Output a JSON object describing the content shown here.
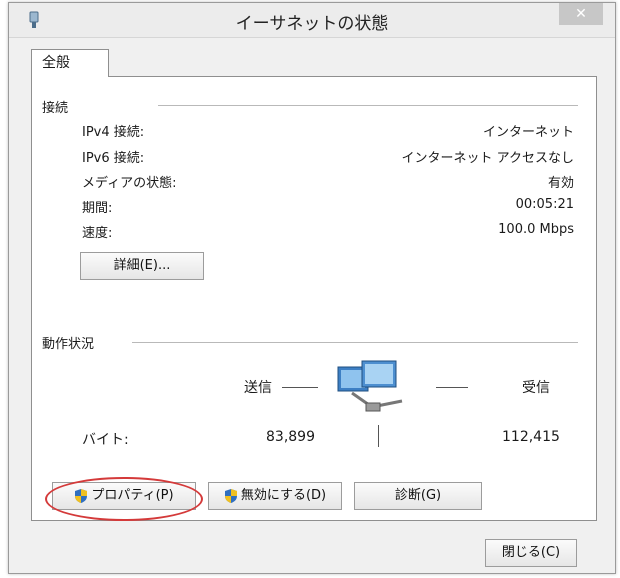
{
  "window": {
    "title": "イーサネットの状態",
    "close_label": "✕"
  },
  "tab": {
    "label": "全般"
  },
  "connection": {
    "section_title": "接続",
    "rows": [
      {
        "label": "IPv4 接続:",
        "value": "インターネット"
      },
      {
        "label": "IPv6 接続:",
        "value": "インターネット アクセスなし"
      },
      {
        "label": "メディアの状態:",
        "value": "有効"
      },
      {
        "label": "期間:",
        "value": "00:05:21"
      },
      {
        "label": "速度:",
        "value": "100.0 Mbps"
      }
    ],
    "details_button": "詳細(E)..."
  },
  "activity": {
    "section_title": "動作状況",
    "sent_label": "送信",
    "received_label": "受信",
    "bytes_label": "バイト:",
    "bytes_sent": "83,899",
    "bytes_received": "112,415",
    "network_icon": "network-computers-icon"
  },
  "buttons": {
    "properties": "プロパティ(P)",
    "disable": "無効にする(D)",
    "diagnose": "診断(G)",
    "close": "閉じる(C)"
  },
  "colors": {
    "highlight": "#d43a3a",
    "panel_border": "#8f8f8f"
  }
}
